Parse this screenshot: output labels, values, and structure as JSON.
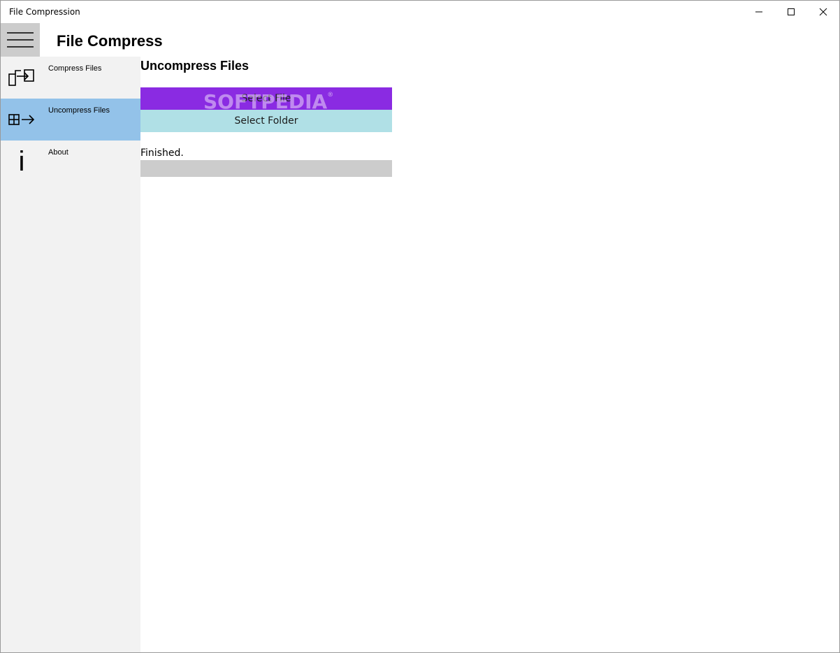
{
  "window": {
    "title": "File Compression",
    "controls": {
      "minimize": "minimize-icon",
      "maximize": "maximize-icon",
      "close": "close-icon"
    }
  },
  "header": {
    "title": "File Compress",
    "menu_icon": "hamburger-icon"
  },
  "sidebar": {
    "items": [
      {
        "label": "Compress Files",
        "icon": "compress-icon",
        "selected": false
      },
      {
        "label": "Uncompress Files",
        "icon": "uncompress-icon",
        "selected": true
      },
      {
        "label": "About",
        "icon": "info-icon",
        "icon_glyph": "i",
        "selected": false
      }
    ]
  },
  "main": {
    "section_title": "Uncompress Files",
    "select_file_label": "Select File",
    "select_folder_label": "Select Folder",
    "status": "Finished.",
    "progress_percent": 0
  },
  "watermark": {
    "text": "SOFTPEDIA",
    "mark": "®"
  },
  "colors": {
    "hamburger_bg": "#cccccc",
    "sidebar_bg": "#f2f2f2",
    "selected_item_bg": "#93c2e9",
    "select_file_bg": "#8a2be2",
    "select_folder_bg": "#b0e0e6",
    "progress_track": "#cccccc"
  }
}
